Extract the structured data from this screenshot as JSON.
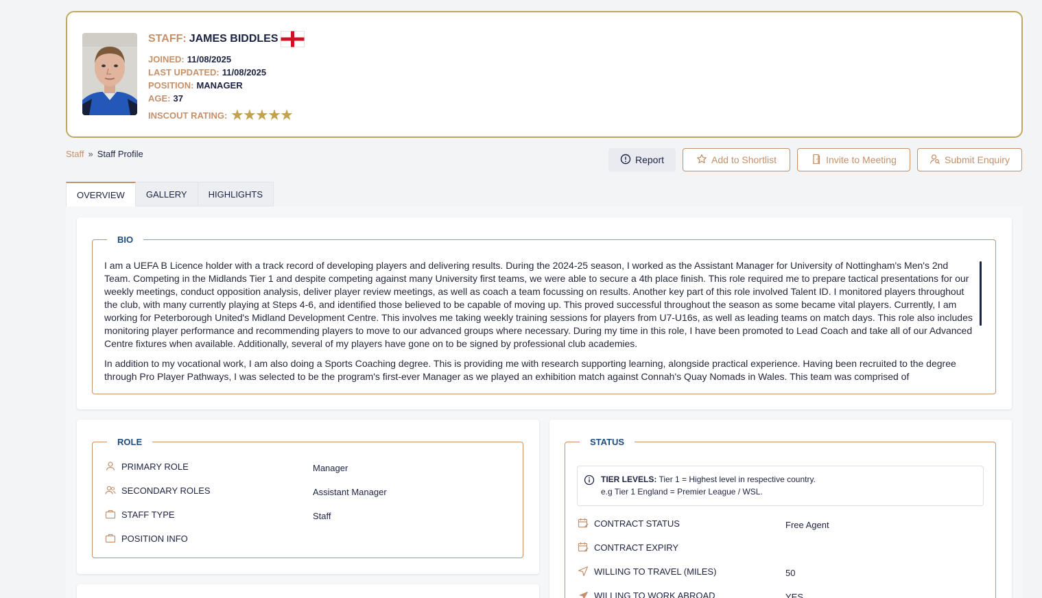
{
  "profile": {
    "name_label": "STAFF:",
    "name": "JAMES BIDDLES",
    "joined_label": "JOINED:",
    "joined": "11/08/2025",
    "updated_label": "LAST UPDATED:",
    "updated": "11/08/2025",
    "position_label": "POSITION:",
    "position": "MANAGER",
    "age_label": "AGE:",
    "age": "37",
    "rating_label": "INSCOUT RATING:",
    "rating_stars": 5
  },
  "breadcrumb": {
    "root": "Staff",
    "sep": "»",
    "current": "Staff Profile"
  },
  "actions": {
    "report": "Report",
    "shortlist": "Add to Shortlist",
    "meeting": "Invite to Meeting",
    "enquiry": "Submit Enquiry"
  },
  "tabs": [
    "OVERVIEW",
    "GALLERY",
    "HIGHLIGHTS"
  ],
  "bio": {
    "title": "BIO",
    "paragraphs": [
      "I am a UEFA B Licence holder with a track record of developing players and delivering results. During the 2024-25 season, I worked as the Assistant Manager for University of Nottingham's Men's 2nd Team. Competing in the Midlands Tier 1 and despite competing against many University first teams, we were able to secure a 4th place finish. This role required me to prepare tactical presentations for our weekly meetings, conduct opposition analysis, deliver player review meetings, as well as coach a team focussing on results. Another key part of this role involved Talent ID. I monitored players throughout the club, with many currently playing at Steps 4-6, and identified those believed to be capable of moving up. This proved successful throughout the season as some became vital players. Currently, I am working for Peterborough United's Midland Development Centre. This involves me taking weekly training sessions for players from U7-U16s, as well as leading teams on match days. This role also includes monitoring player performance and recommending players to move to our advanced groups where necessary. During my time in this role, I have been promoted to Lead Coach and take all of our Advanced Centre fixtures when available. Additionally, several of my players have gone on to be signed by professional club academies.",
      "In addition to my vocational work, I am also doing a Sports Coaching degree. This is providing me with research supporting learning, alongside practical experience. Having been recruited to the degree through Pro Player Pathways, I was selected to be the program's first-ever Manager as we played an exhibition match against Connah's Quay Nomads in Wales. This team was comprised of"
    ]
  },
  "role": {
    "title": "ROLE",
    "primary_label": "PRIMARY ROLE",
    "primary_value": "Manager",
    "secondary_label": "SECONDARY ROLES",
    "secondary_value": "Assistant Manager",
    "type_label": "STAFF TYPE",
    "type_value": "Staff",
    "position_label": "POSITION INFO"
  },
  "status": {
    "title": "STATUS",
    "tier_label": "TIER LEVELS:",
    "tier_text": "Tier 1 = Highest level in respective country.",
    "tier_example": "e.g Tier 1 England = Premier League / WSL.",
    "contract_status_label": "CONTRACT STATUS",
    "contract_status_value": "Free Agent",
    "contract_expiry_label": "CONTRACT EXPIRY",
    "travel_label": "WILLING TO TRAVEL (MILES)",
    "travel_value": "50",
    "abroad_label": "WILLING TO WORK ABROAD",
    "abroad_value": "YES"
  },
  "colors": {
    "accent": "#c4906a",
    "navy": "#1b2140",
    "legend": "#1c4a7c",
    "gold_border": "#bda95a",
    "star": "#c2a24e"
  },
  "icons": [
    "flag-england-icon",
    "star-icon",
    "alert-circle-icon",
    "star-outline-icon",
    "door-icon",
    "user-search-icon",
    "user-icon",
    "users-icon",
    "briefcase-icon",
    "info-icon",
    "calendar-edit-icon",
    "navigation-icon",
    "plane-icon"
  ]
}
